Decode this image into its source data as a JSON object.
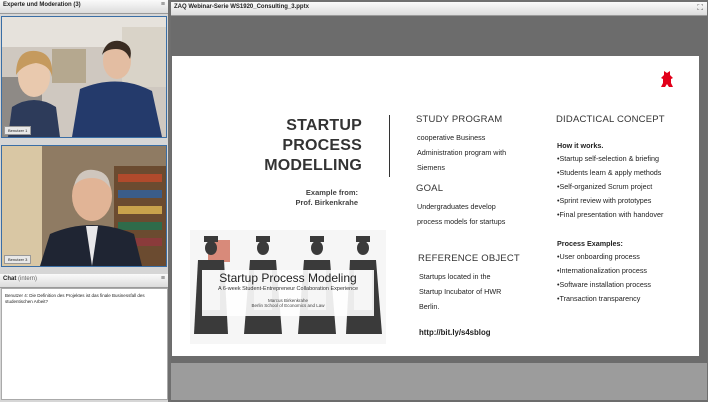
{
  "left_panel": {
    "title": "Experte und Moderation",
    "title_count": "(3)",
    "cam1_label": "Benutzer 1",
    "cam2_label": "Benutzer 3"
  },
  "chat": {
    "title": "Chat",
    "title_tag": "(intern)",
    "message": "Benutzer 4: Die Definition des Projektes ist das finale Businessfall des studentischen Arbeit?"
  },
  "document": {
    "title": "ZAQ Webinar-Serie WS1920_Consulting_3.pptx"
  },
  "slide": {
    "title_lines": [
      "STARTUP",
      "PROCESS",
      "MODELLING"
    ],
    "example_line1": "Example from:",
    "example_line2": "Prof. Birkenkrahe",
    "banner_title": "Startup Process Modeling",
    "banner_sub": "A 6-week Student-Entrepreneur Collaboration Experience",
    "banner_name": "Marcus Birkenkrahe",
    "banner_school": "Berlin School of Economics and Law",
    "study_head": "STUDY PROGRAM",
    "study_text": [
      "cooperative Business",
      "Administration program with",
      "Siemens"
    ],
    "goal_head": "GOAL",
    "goal_text": [
      "Undergraduates develop",
      "process models for startups"
    ],
    "ref_head": "REFERENCE OBJECT",
    "ref_text": [
      "Startups located in the",
      "Startup Incubator of HWR",
      "Berlin."
    ],
    "link": "http://bit.ly/s4sblog",
    "did_head": "DIDACTICAL CONCEPT",
    "how_head": "How it works.",
    "how_items": [
      "•Startup self-selection & briefing",
      "•Students learn & apply methods",
      "•Self-organized Scrum project",
      "•Sprint review with prototypes",
      "•Final presentation with handover"
    ],
    "proc_head": "Process Examples:",
    "proc_items": [
      "•User onboarding process",
      "•Internationalization process",
      "•Software installation process",
      "•Transaction transparency"
    ]
  },
  "colors": {
    "logo_red": "#e2001a",
    "frame_blue": "#3a6ea5"
  }
}
